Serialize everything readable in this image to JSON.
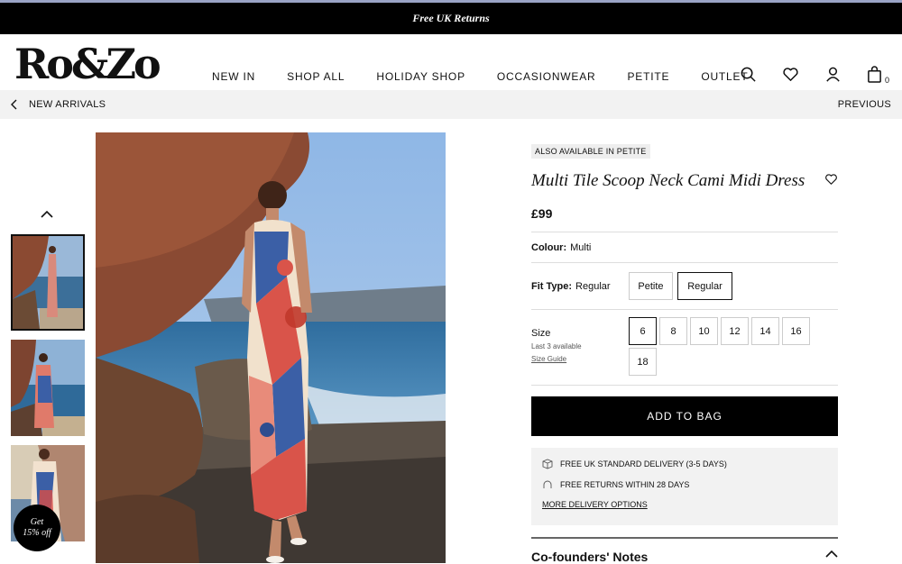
{
  "banner": {
    "text": "Free UK Returns"
  },
  "header": {
    "logo": "Ro&Zo",
    "nav": [
      "NEW IN",
      "SHOP ALL",
      "HOLIDAY SHOP",
      "OCCASIONWEAR",
      "PETITE",
      "OUTLET"
    ],
    "bag_count": "0",
    "icons": [
      "search-icon",
      "heart-icon",
      "user-icon",
      "bag-icon"
    ]
  },
  "breadcrumb": {
    "back_label": "NEW ARRIVALS",
    "previous_label": "PREVIOUS"
  },
  "product": {
    "badge": "ALSO AVAILABLE IN PETITE",
    "title": "Multi Tile Scoop Neck Cami Midi Dress",
    "price": "£99",
    "colour_label": "Colour:",
    "colour_value": "Multi",
    "fit_label": "Fit Type:",
    "fit_value": "Regular",
    "fit_options": [
      "Petite",
      "Regular"
    ],
    "fit_selected": "Regular",
    "size_label": "Size",
    "stock_note": "Last 3 available",
    "size_guide": "Size Guide",
    "sizes": [
      "6",
      "8",
      "10",
      "12",
      "14",
      "16",
      "18"
    ],
    "size_selected": "6",
    "add_to_bag": "ADD TO BAG",
    "delivery_lines": [
      "FREE UK STANDARD DELIVERY (3-5 DAYS)",
      "FREE RETURNS WITHIN 28 DAYS"
    ],
    "delivery_link": "MORE DELIVERY OPTIONS",
    "notes_title": "Co-founders' Notes"
  },
  "promo": {
    "line1": "Get",
    "line2": "15% off"
  }
}
